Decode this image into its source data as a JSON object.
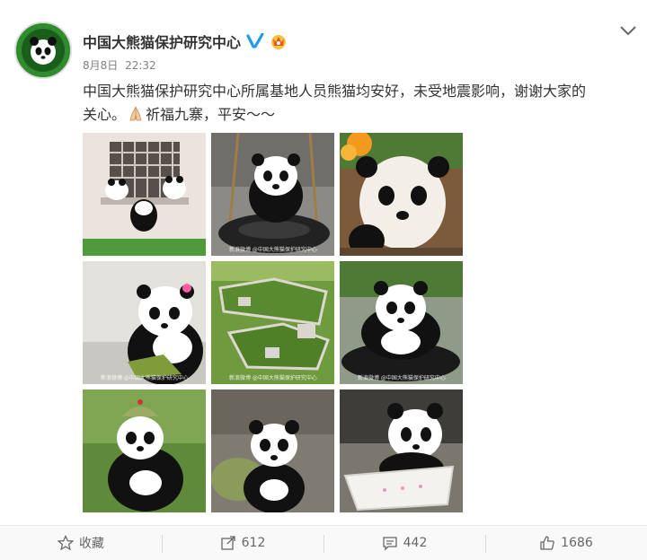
{
  "post": {
    "author": "中国大熊猫保护研究中心",
    "date": "8月8日",
    "time": "22:32",
    "text_line1": "中国大熊猫保护研究中心所属基地人员熊猫均安好，未受地震影响，谢谢大家的",
    "text_line2_a": "关心。",
    "text_line2_b": "祈福九寨，平安～～",
    "watermark": "新浪微博 @中国大熊猫保护研究中心"
  },
  "icons": {
    "avatar": "panda-logo-avatar",
    "verified": "verified-v-icon",
    "vip": "vip-crown-icon",
    "more": "chevron-down-icon",
    "pray": "praying-hands-icon"
  },
  "images": [
    {
      "name": "photo-pandas-window"
    },
    {
      "name": "photo-panda-tire-swing"
    },
    {
      "name": "photo-panda-flowers"
    },
    {
      "name": "photo-panda-pink-bow"
    },
    {
      "name": "photo-base-aerial-view"
    },
    {
      "name": "photo-panda-in-tire"
    },
    {
      "name": "photo-panda-green-hat"
    },
    {
      "name": "photo-panda-rocks"
    },
    {
      "name": "photo-panda-bathtub"
    }
  ],
  "actions": {
    "favorite_label": "收藏",
    "repost_count": "612",
    "comment_count": "442",
    "like_count": "1686"
  },
  "colors": {
    "brand_green": "#1f7a1f",
    "verified_blue": "#1d9bf0",
    "text": "#333333",
    "meta": "#808080"
  }
}
